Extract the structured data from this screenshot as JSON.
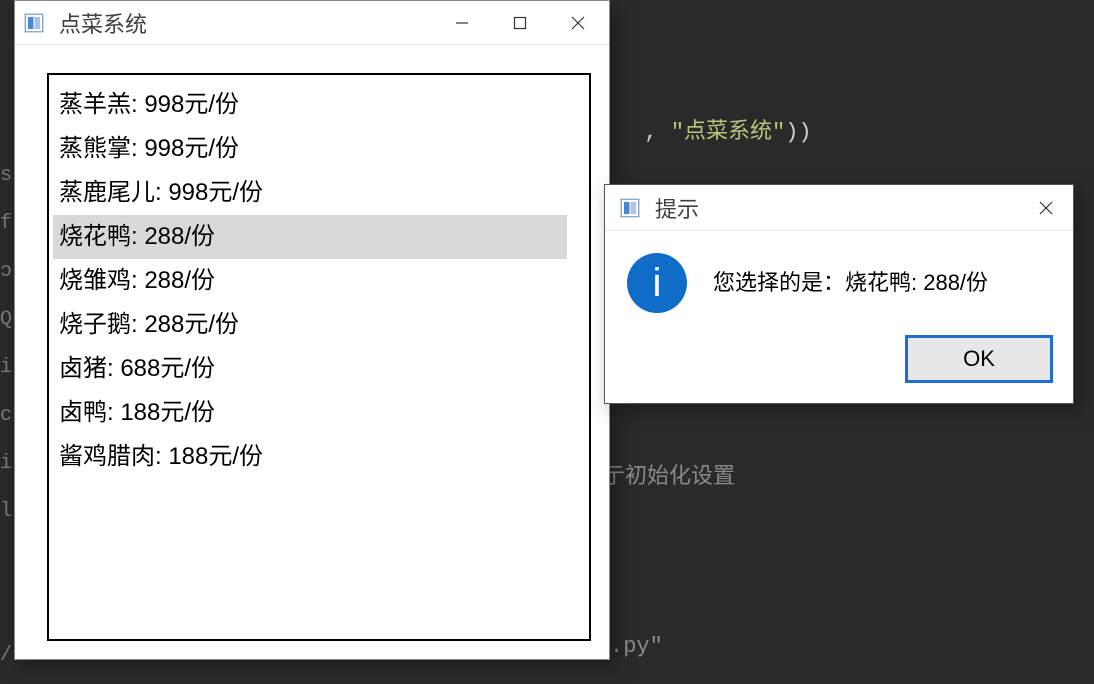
{
  "background": {
    "code_line_1_prefix": ", ",
    "code_line_1_string": "\"点菜系统\"",
    "code_line_1_suffix": "))",
    "code_line_2": "亍初始化设置",
    "code_line_3": ".py\""
  },
  "main_window": {
    "title": "点菜系统",
    "selected_index": 3,
    "items": [
      "蒸羊羔: 998元/份",
      "蒸熊掌: 998元/份",
      "蒸鹿尾儿: 998元/份",
      "烧花鸭: 288/份",
      "烧雏鸡: 288/份",
      "烧子鹅: 288元/份",
      "卤猪: 688元/份",
      "卤鸭: 188元/份",
      "酱鸡腊肉: 188元/份"
    ]
  },
  "dialog": {
    "title": "提示",
    "message": "您选择的是：烧花鸭: 288/份",
    "ok_label": "OK"
  }
}
